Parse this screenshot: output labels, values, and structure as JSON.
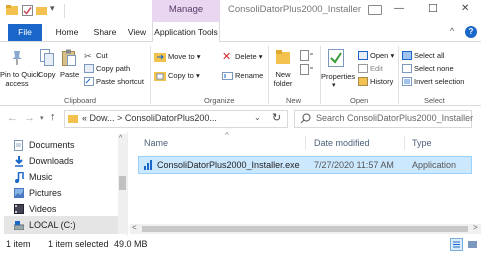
{
  "window": {
    "manage_tab": "Manage",
    "title": "ConsoliDatorPlus2000_Installer",
    "minimize": "—",
    "maximize": "☐",
    "close": "✕"
  },
  "ribbon_tabs": [
    "File",
    "Home",
    "Share",
    "View",
    "Application Tools"
  ],
  "clipboard": {
    "pin_label": [
      "Pin to Quick",
      "access"
    ],
    "copy": "Copy",
    "paste": "Paste",
    "cut": "Cut",
    "copy_path": "Copy path",
    "paste_shortcut": "Paste shortcut",
    "group": "Clipboard"
  },
  "organize": {
    "move_to": "Move to",
    "copy_to": "Copy to",
    "delete": "Delete",
    "rename": "Rename",
    "group": "Organize"
  },
  "new_group": {
    "new_folder": [
      "New",
      "folder"
    ],
    "group": "New"
  },
  "open_group": {
    "properties": "Properties",
    "open": "Open",
    "edit": "Edit",
    "history": "History",
    "group": "Open"
  },
  "select_group": {
    "select_all": "Select all",
    "select_none": "Select none",
    "invert": "Invert selection",
    "group": "Select"
  },
  "address": {
    "overflow": "«",
    "crumb1": "Dow...",
    "sep": ">",
    "crumb2": "ConsoliDatorPlus200...",
    "search_placeholder": "Search ConsoliDatorPlus2000_Installer"
  },
  "nav_items": [
    {
      "label": "Documents",
      "icon": "documents-icon"
    },
    {
      "label": "Downloads",
      "icon": "download-arrow-icon"
    },
    {
      "label": "Music",
      "icon": "music-note-icon"
    },
    {
      "label": "Pictures",
      "icon": "pictures-icon"
    },
    {
      "label": "Videos",
      "icon": "videos-icon"
    },
    {
      "label": "LOCAL (C:)",
      "icon": "drive-icon"
    }
  ],
  "columns": {
    "name": "Name",
    "date": "Date modified",
    "type": "Type"
  },
  "file": {
    "name": "ConsoliDatorPlus2000_Installer.exe",
    "date": "7/27/2020 11:57 AM",
    "type": "Application"
  },
  "status": {
    "count": "1 item",
    "selected": "1 item selected",
    "size": "49.0 MB"
  },
  "colors": {
    "file_tab": "#1b67c9",
    "manage_tab": "#e9d6f1",
    "selection": "#cce8ff",
    "folder": "#f2c14e",
    "help": "#1b67c9"
  }
}
